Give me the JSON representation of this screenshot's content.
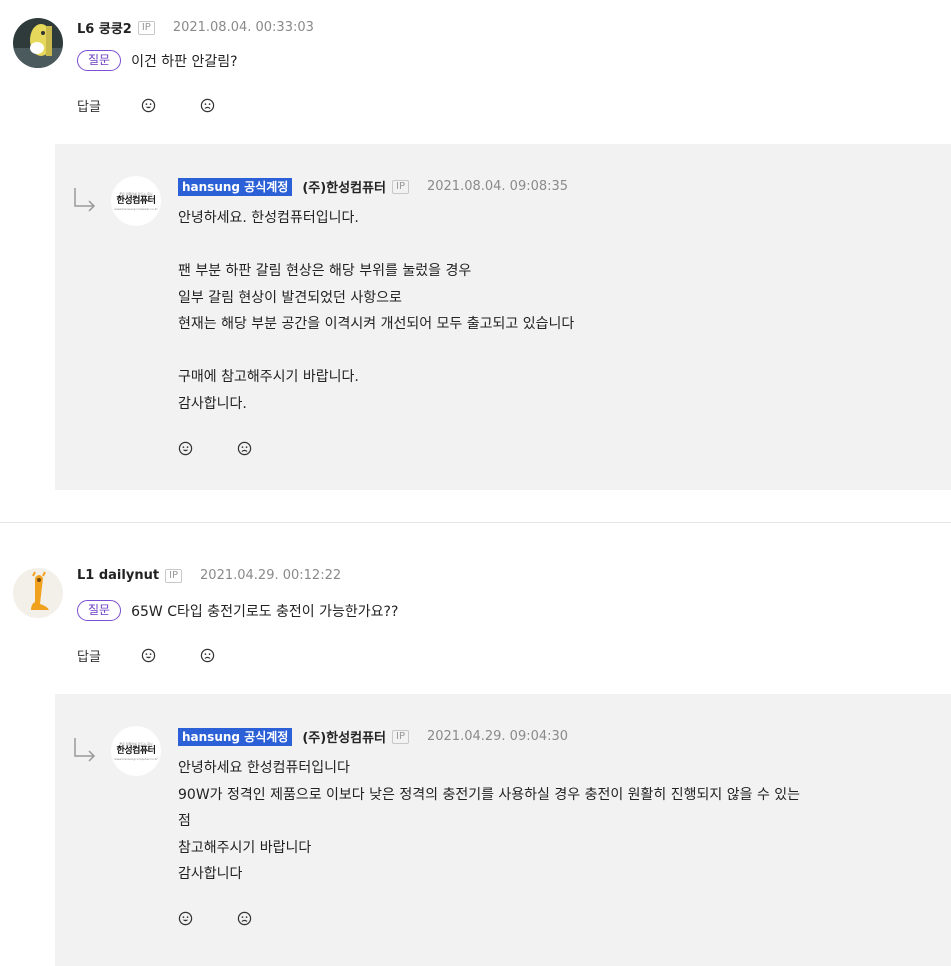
{
  "comments": [
    {
      "user_level_name": "L6 쿵쿵2",
      "ip_label": "IP",
      "date": "2021.08.04. 00:33:03",
      "badge": "질문",
      "question": "이건 하판 안갈림?",
      "reply_label": "답글",
      "answer": {
        "official_label": "hansung 공식계정",
        "corp_name": "(주)한성컴퓨터",
        "ip_label": "IP",
        "date": "2021.08.04. 09:08:35",
        "avatar_text": "한성컴퓨터",
        "avatar_tiny_top": "좋은 컴퓨터를 만드는 회사",
        "avatar_tiny_bottom": "www.hansungcomputer.co.kr",
        "body": "안녕하세요. 한성컴퓨터입니다.\n\n팬 부분 하판 갈림 현상은 해당 부위를 눌렀을 경우\n일부 갈림 현상이 발견되었던 사항으로\n현재는 해당 부분 공간을 이격시켜 개선되어 모두 출고되고 있습니다\n\n구매에 참고해주시기 바랍니다.\n감사합니다."
      }
    },
    {
      "user_level_name": "L1 dailynut",
      "ip_label": "IP",
      "date": "2021.04.29. 00:12:22",
      "badge": "질문",
      "question": "65W C타입 충전기로도 충전이 가능한가요??",
      "reply_label": "답글",
      "answer": {
        "official_label": "hansung 공식계정",
        "corp_name": "(주)한성컴퓨터",
        "ip_label": "IP",
        "date": "2021.04.29. 09:04:30",
        "avatar_text": "한성컴퓨터",
        "avatar_tiny_top": "좋은 컴퓨터를 만드는 회사",
        "avatar_tiny_bottom": "www.hansungcomputer.co.kr",
        "body": "안녕하세요 한성컴퓨터입니다\n90W가 정격인 제품으로 이보다 낮은 정격의 충전기를 사용하실 경우 충전이 원활히 진행되지 않을 수 있는\n점\n참고해주시기 바랍니다\n감사합니다"
      }
    }
  ],
  "icons": {
    "like": "smile-icon",
    "dislike": "frown-icon",
    "reply_arrow": "reply-arrow-icon"
  }
}
